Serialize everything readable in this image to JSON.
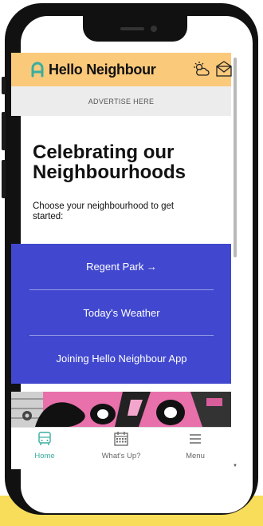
{
  "header": {
    "app_name": "Hello Neighbour",
    "icons": [
      "home-outline-icon",
      "sun-cloud-weather-icon",
      "mail-envelope-icon"
    ]
  },
  "advert": {
    "label": "ADVERTISE HERE"
  },
  "hero": {
    "title": "Celebrating our Neighbourhoods",
    "subtitle": "Choose your neighbourhood to get started:"
  },
  "menu": {
    "items": [
      {
        "label": "Regent Park →"
      },
      {
        "label": "Today's Weather"
      },
      {
        "label": "Joining Hello Neighbour App"
      }
    ]
  },
  "bottom_nav": {
    "items": [
      {
        "label": "Home",
        "icon": "bus-icon",
        "active": true
      },
      {
        "label": "What's Up?",
        "icon": "calendar-icon",
        "active": false
      },
      {
        "label": "Menu",
        "icon": "hamburger-menu-icon",
        "active": false
      }
    ]
  },
  "colors": {
    "header_bg": "#fbc97a",
    "menu_bg": "#4148cf",
    "active_nav": "#3aaea0",
    "bottom_strip": "#f7dd5a"
  }
}
